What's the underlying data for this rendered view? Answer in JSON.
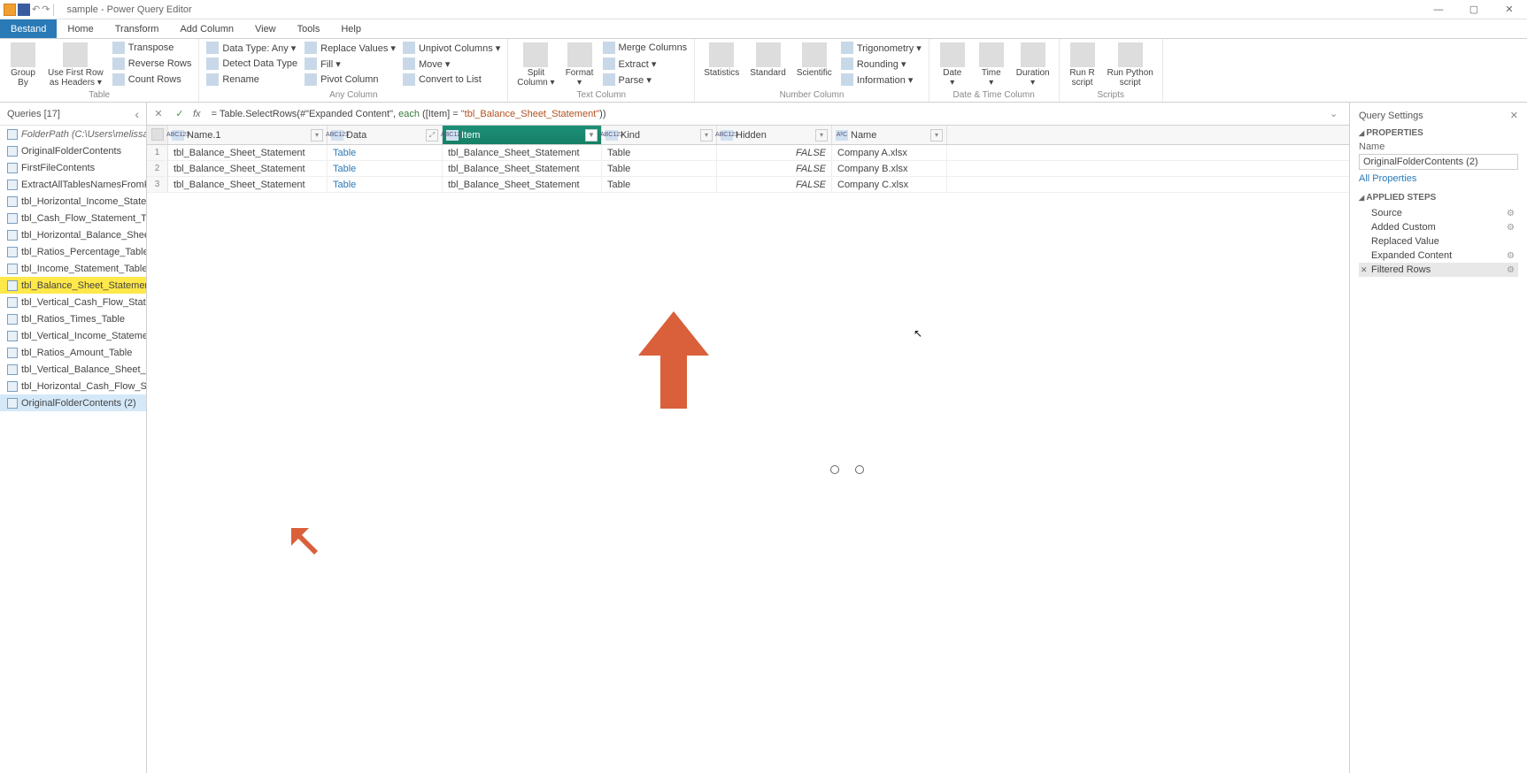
{
  "title": "sample - Power Query Editor",
  "tabs": [
    "Bestand",
    "Home",
    "Transform",
    "Add Column",
    "View",
    "Tools",
    "Help"
  ],
  "activeTab": 0,
  "ribbon": {
    "groups": [
      {
        "label": "Table",
        "big": [
          {
            "label": "Group\nBy"
          },
          {
            "label": "Use First Row\nas Headers ▾"
          }
        ],
        "small": [
          {
            "label": "Transpose"
          },
          {
            "label": "Reverse Rows"
          },
          {
            "label": "Count Rows"
          }
        ]
      },
      {
        "label": "Any Column",
        "small": [
          {
            "label": "Data Type: Any ▾"
          },
          {
            "label": "Detect Data Type"
          },
          {
            "label": "Rename"
          },
          {
            "label": "Replace Values ▾"
          },
          {
            "label": "Fill ▾"
          },
          {
            "label": "Pivot Column"
          },
          {
            "label": "Unpivot Columns ▾"
          },
          {
            "label": "Move ▾"
          },
          {
            "label": "Convert to List"
          }
        ]
      },
      {
        "label": "Text Column",
        "big": [
          {
            "label": "Split\nColumn ▾"
          },
          {
            "label": "Format\n▾"
          }
        ],
        "small": [
          {
            "label": "Merge Columns"
          },
          {
            "label": "Extract ▾"
          },
          {
            "label": "Parse ▾"
          }
        ]
      },
      {
        "label": "Number Column",
        "big": [
          {
            "label": "Statistics\n "
          },
          {
            "label": "Standard\n "
          },
          {
            "label": "Scientific\n "
          }
        ],
        "small": [
          {
            "label": "Trigonometry ▾"
          },
          {
            "label": "Rounding ▾"
          },
          {
            "label": "Information ▾"
          }
        ]
      },
      {
        "label": "Date & Time Column",
        "big": [
          {
            "label": "Date\n▾"
          },
          {
            "label": "Time\n▾"
          },
          {
            "label": "Duration\n▾"
          }
        ]
      },
      {
        "label": "Scripts",
        "big": [
          {
            "label": "Run R\nscript"
          },
          {
            "label": "Run Python\nscript"
          }
        ]
      }
    ]
  },
  "queriesPanel": {
    "title": "Queries [17]",
    "items": [
      {
        "label": "FolderPath (C:\\Users\\melissa\\…",
        "folder": true
      },
      {
        "label": "OriginalFolderContents"
      },
      {
        "label": "FirstFileContents"
      },
      {
        "label": "ExtractAllTablesNamesFromFi…"
      },
      {
        "label": "tbl_Horizontal_Income_State…"
      },
      {
        "label": "tbl_Cash_Flow_Statement_Ta…"
      },
      {
        "label": "tbl_Horizontal_Balance_Sheet…"
      },
      {
        "label": "tbl_Ratios_Percentage_Table"
      },
      {
        "label": "tbl_Income_Statement_Table"
      },
      {
        "label": "tbl_Balance_Sheet_Statement…",
        "highlighted": true
      },
      {
        "label": "tbl_Vertical_Cash_Flow_State…"
      },
      {
        "label": "tbl_Ratios_Times_Table"
      },
      {
        "label": "tbl_Vertical_Income_Stateme…"
      },
      {
        "label": "tbl_Ratios_Amount_Table"
      },
      {
        "label": "tbl_Vertical_Balance_Sheet_Ta…"
      },
      {
        "label": "tbl_Horizontal_Cash_Flow_Sta…"
      },
      {
        "label": "OriginalFolderContents (2)",
        "selected": true
      }
    ]
  },
  "formula": {
    "prefix": "= Table.SelectRows(#\"Expanded Content\", ",
    "each": "each",
    "mid": " ([Item] = ",
    "str": "\"tbl_Balance_Sheet_Statement\"",
    "suffix": "))"
  },
  "grid": {
    "columns": [
      {
        "name": "Name.1",
        "type": "ABC123",
        "filter": "▾"
      },
      {
        "name": "Data",
        "type": "ABC123",
        "filter": "⤢"
      },
      {
        "name": "Item",
        "type": "ABC123",
        "filter": "▾",
        "active": true,
        "filtered": true
      },
      {
        "name": "Kind",
        "type": "ABC123",
        "filter": "▾"
      },
      {
        "name": "Hidden",
        "type": "ABC123",
        "filter": "▾"
      },
      {
        "name": "Name",
        "type": "AᵇC",
        "filter": "▾"
      }
    ],
    "rows": [
      {
        "n": 1,
        "cells": [
          "tbl_Balance_Sheet_Statement",
          "Table",
          "tbl_Balance_Sheet_Statement",
          "Table",
          "FALSE",
          "Company A.xlsx"
        ]
      },
      {
        "n": 2,
        "cells": [
          "tbl_Balance_Sheet_Statement",
          "Table",
          "tbl_Balance_Sheet_Statement",
          "Table",
          "FALSE",
          "Company B.xlsx"
        ]
      },
      {
        "n": 3,
        "cells": [
          "tbl_Balance_Sheet_Statement",
          "Table",
          "tbl_Balance_Sheet_Statement",
          "Table",
          "FALSE",
          "Company C.xlsx"
        ]
      }
    ]
  },
  "settings": {
    "title": "Query Settings",
    "propsTitle": "PROPERTIES",
    "nameLabel": "Name",
    "nameValue": "OriginalFolderContents (2)",
    "allProps": "All Properties",
    "stepsTitle": "APPLIED STEPS",
    "steps": [
      {
        "label": "Source",
        "gear": true
      },
      {
        "label": "Added Custom",
        "gear": true
      },
      {
        "label": "Replaced Value"
      },
      {
        "label": "Expanded Content",
        "gear": true
      },
      {
        "label": "Filtered Rows",
        "active": true,
        "gear": true,
        "del": true
      }
    ]
  }
}
